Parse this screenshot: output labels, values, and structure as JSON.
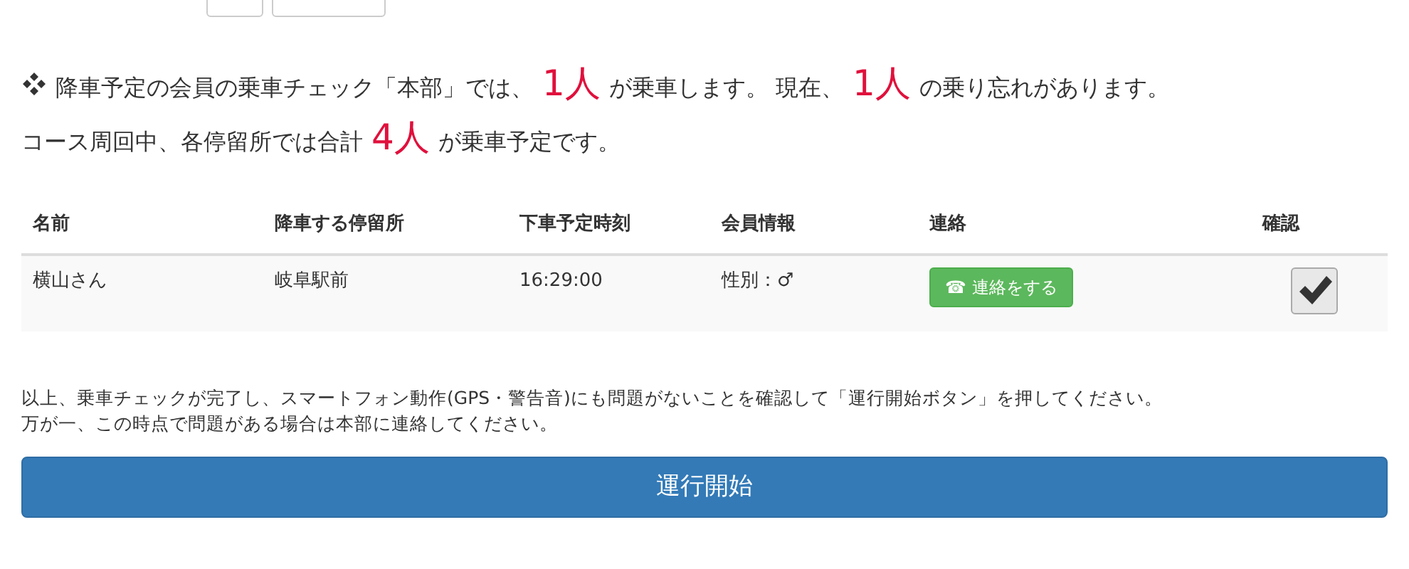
{
  "summary_lines": [
    {
      "parts": [
        {
          "kind": "text",
          "text": "降車予定の会員の乗車チェック「本部」では、"
        },
        {
          "kind": "count",
          "text": "1人"
        },
        {
          "kind": "text",
          "text": "が乗車します。 現在、"
        },
        {
          "kind": "count",
          "text": "1人"
        },
        {
          "kind": "text",
          "text": "の乗り忘れがあります。"
        }
      ]
    },
    {
      "parts": [
        {
          "kind": "text",
          "text": "コース周回中、各停留所では合計"
        },
        {
          "kind": "count",
          "text": "4人"
        },
        {
          "kind": "text",
          "text": "が乗車予定です。"
        }
      ]
    }
  ],
  "table": {
    "columns": [
      "名前",
      "降車する停留所",
      "下車予定時刻",
      "会員情報",
      "連絡",
      "確認"
    ],
    "rows": [
      {
        "name": "横山さん",
        "stop": "岐阜駅前",
        "time": "16:29:00",
        "info": "性別：♂",
        "contact": "☎ 連絡をする",
        "confirmed": true
      }
    ]
  },
  "notice": [
    "以上、乗車チェックが完了し、スマートフォン動作(GPS・警告音)にも問題がないことを確認して「運行開始ボタン」を押してください。",
    "万が一、この時点で問題がある場合は本部に連絡してください。"
  ],
  "start_button": "運行開始"
}
